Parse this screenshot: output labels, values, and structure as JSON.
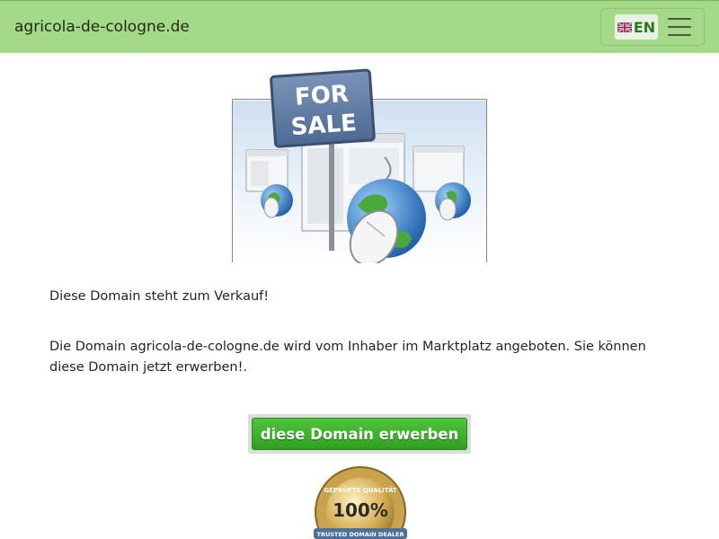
{
  "header": {
    "domain_title": "agricola-de-cologne.de",
    "language_label": "EN",
    "flag_icon": "uk-flag-icon",
    "menu_icon": "hamburger-menu-icon",
    "bg_color": "#a3d987"
  },
  "hero": {
    "sign_text_line1": "FOR",
    "sign_text_line2": "SALE"
  },
  "content": {
    "headline": "Diese Domain steht zum Verkauf!",
    "description": "Die Domain agricola-de-cologne.de wird vom Inhaber im Marktplatz angeboten. Sie können diese Domain jetzt erwerben!."
  },
  "cta": {
    "buy_label": "diese Domain erwerben",
    "color": "#3bb22c"
  },
  "seal": {
    "top_text": "GEPRÜFTE QUALITÄT",
    "percent": "100%",
    "bottom_text": "TRUSTED DOMAIN DEALER"
  }
}
